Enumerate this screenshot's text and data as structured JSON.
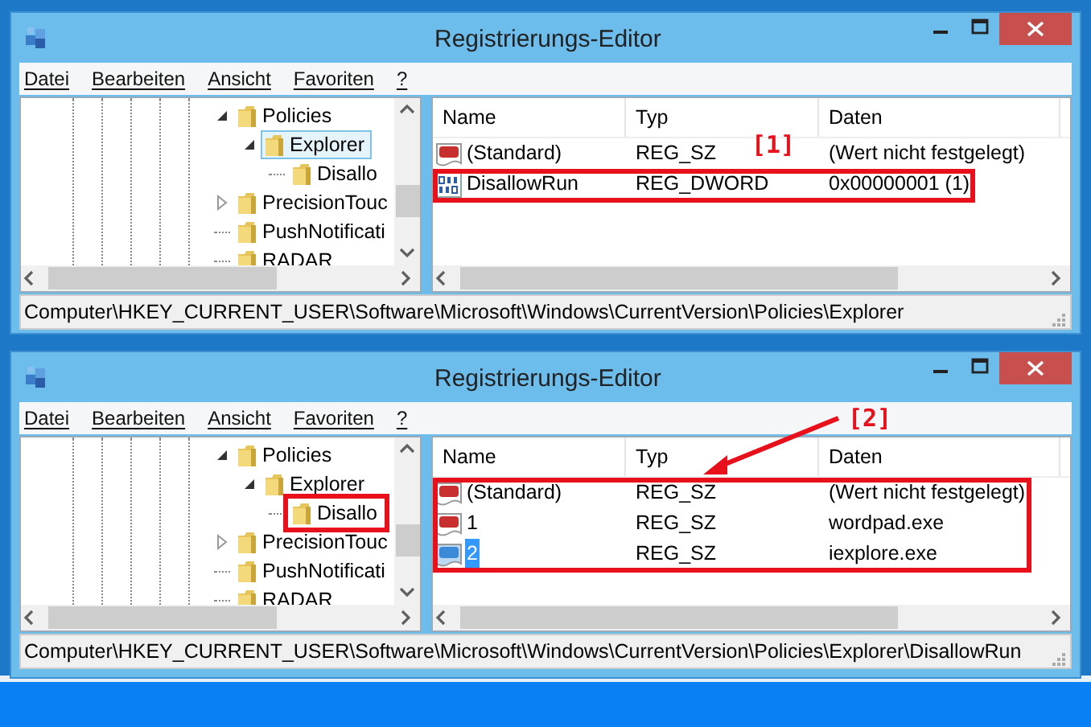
{
  "windows": [
    {
      "title": "Registrierungs-Editor",
      "menu": [
        "Datei",
        "Bearbeiten",
        "Ansicht",
        "Favoriten",
        "?"
      ],
      "tree": [
        {
          "label": "Policies",
          "expanded": true,
          "selected": false,
          "marked": false,
          "children": [
            {
              "label": "Explorer",
              "expanded": true,
              "selected": true,
              "marked": false,
              "children": [
                {
                  "label": "Disallo",
                  "selected": false,
                  "marked": false
                }
              ]
            }
          ]
        },
        {
          "label": "PrecisionTouc",
          "expanded": false,
          "selected": false,
          "marked": false
        },
        {
          "label": "PushNotificati",
          "selected": false,
          "marked": false
        },
        {
          "label": "RADAR",
          "selected": false,
          "marked": false
        }
      ],
      "columns": [
        "Name",
        "Typ",
        "Daten"
      ],
      "rows": [
        {
          "kind": "string",
          "name": "(Standard)",
          "type": "REG_SZ",
          "data": "(Wert nicht festgelegt)",
          "selected": false,
          "marked": false
        },
        {
          "kind": "dword",
          "name": "DisallowRun",
          "type": "REG_DWORD",
          "data": "0x00000001 (1)",
          "selected": false,
          "marked": true
        }
      ],
      "callout": {
        "label": "[1]",
        "arrow": false
      },
      "status": "Computer\\HKEY_CURRENT_USER\\Software\\Microsoft\\Windows\\CurrentVersion\\Policies\\Explorer"
    },
    {
      "title": "Registrierungs-Editor",
      "menu": [
        "Datei",
        "Bearbeiten",
        "Ansicht",
        "Favoriten",
        "?"
      ],
      "tree": [
        {
          "label": "Policies",
          "expanded": true,
          "selected": false,
          "marked": false,
          "children": [
            {
              "label": "Explorer",
              "expanded": true,
              "selected": false,
              "marked": false,
              "children": [
                {
                  "label": "Disallo",
                  "selected": false,
                  "marked": true
                }
              ]
            }
          ]
        },
        {
          "label": "PrecisionTouc",
          "expanded": false,
          "selected": false,
          "marked": false
        },
        {
          "label": "PushNotificati",
          "selected": false,
          "marked": false
        },
        {
          "label": "RADAR",
          "selected": false,
          "marked": false
        }
      ],
      "columns": [
        "Name",
        "Typ",
        "Daten"
      ],
      "rows": [
        {
          "kind": "string",
          "name": "(Standard)",
          "type": "REG_SZ",
          "data": "(Wert nicht festgelegt)",
          "selected": false,
          "marked": true
        },
        {
          "kind": "string",
          "name": "1",
          "type": "REG_SZ",
          "data": "wordpad.exe",
          "selected": false,
          "marked": true
        },
        {
          "kind": "string",
          "name": "2",
          "type": "REG_SZ",
          "data": "iexplore.exe",
          "selected": true,
          "marked": true
        }
      ],
      "callout": {
        "label": "[2]",
        "arrow": true
      },
      "status": "Computer\\HKEY_CURRENT_USER\\Software\\Microsoft\\Windows\\CurrentVersion\\Policies\\Explorer\\DisallowRun"
    }
  ]
}
